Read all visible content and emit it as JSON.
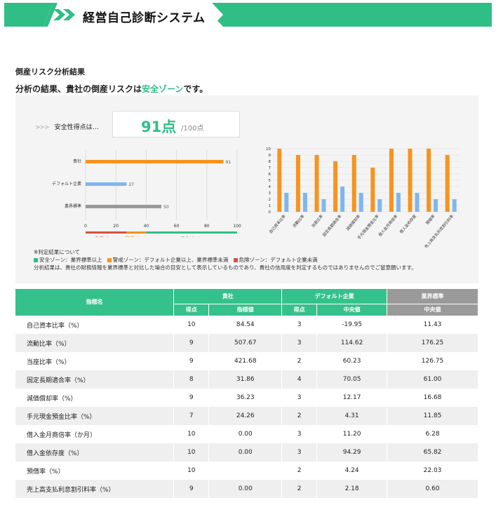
{
  "header": {
    "title": "経営自己診断システム",
    "arrow_icon": "double-chevron-right-icon"
  },
  "section_title": "倒産リスク分析結果",
  "result": {
    "prefix": "分析の結果、貴社の倒産リスクは",
    "zone": "安全ゾーン",
    "suffix": "です。"
  },
  "score": {
    "label": "安全性得点は…",
    "value": "91点",
    "max": "/100点"
  },
  "colors": {
    "green": "#2fbf86",
    "orange": "#f7931e",
    "blue": "#7fb6ee",
    "gray": "#9a9a9a",
    "red": "#d9503f"
  },
  "notes": {
    "heading": "※判定結果について",
    "safe": "安全ゾーン：業界標準以上",
    "warn": "警戒ゾーン：デフォルト企業以上、業界標準未満",
    "danger": "危険ゾーン：デフォルト企業未満",
    "disclaimer": "分析結果は、貴社の財務情報を業界標準と対比した場合の目安として表示しているものであり、貴社の信用度を判定するものではありませんのでご留意願います。"
  },
  "chart_data": [
    {
      "type": "bar",
      "orientation": "horizontal",
      "categories": [
        "貴社",
        "デフォルト企業",
        "業界標準"
      ],
      "values": [
        91,
        27,
        50
      ],
      "value_labels": [
        "91",
        "27",
        "50"
      ],
      "xlim": [
        0,
        100
      ],
      "ticks": [
        "0",
        "20",
        "40",
        "60",
        "80",
        "100"
      ],
      "zones": [
        {
          "label": "危険ゾーン",
          "from": 0,
          "to": 27,
          "color": "#d9503f"
        },
        {
          "label": "警戒ゾーン",
          "from": 27,
          "to": 40,
          "color": "#f7931e"
        },
        {
          "label": "安全ゾーン",
          "from": 40,
          "to": 100,
          "color": "#2fbf86"
        }
      ]
    },
    {
      "type": "bar",
      "categories": [
        "自己資本比率",
        "流動比率",
        "当座比率",
        "固定長期適合率",
        "減価償却率",
        "手元現金預金比率",
        "借入金月商倍率",
        "借入金依存度",
        "預借率",
        "売上高支払利息割引料率"
      ],
      "series": [
        {
          "values": [
            10,
            9,
            9,
            8,
            9,
            7,
            10,
            10,
            10,
            9
          ]
        },
        {
          "values": [
            3,
            3,
            2,
            4,
            3,
            2,
            3,
            3,
            2,
            2
          ]
        }
      ],
      "ylim": [
        0,
        10
      ],
      "ticks": [
        "0",
        "1",
        "2",
        "3",
        "4",
        "5",
        "6",
        "7",
        "8",
        "9",
        "10"
      ]
    }
  ],
  "table": {
    "col_name": "指標名",
    "group_company": "貴社",
    "group_default": "デフォルト企業",
    "group_industry": "業界標準",
    "sub_score": "得点",
    "sub_value": "指標値",
    "sub_median": "中央値",
    "rows": [
      {
        "name": "自己資本比率（%）",
        "score": "10",
        "value": "84.54",
        "d_score": "3",
        "d_median": "-19.95",
        "i_median": "11.43"
      },
      {
        "name": "流動比率（%）",
        "score": "9",
        "value": "507.67",
        "d_score": "3",
        "d_median": "114.62",
        "i_median": "176.25"
      },
      {
        "name": "当座比率（%）",
        "score": "9",
        "value": "421.68",
        "d_score": "2",
        "d_median": "60.23",
        "i_median": "126.75"
      },
      {
        "name": "固定長期適合率（%）",
        "score": "8",
        "value": "31.86",
        "d_score": "4",
        "d_median": "70.05",
        "i_median": "61.00"
      },
      {
        "name": "減価償却率（%）",
        "score": "9",
        "value": "36.23",
        "d_score": "3",
        "d_median": "12.17",
        "i_median": "16.68"
      },
      {
        "name": "手元現金預金比率（%）",
        "score": "7",
        "value": "24.26",
        "d_score": "2",
        "d_median": "4.31",
        "i_median": "11.85"
      },
      {
        "name": "借入金月商倍率（か月）",
        "score": "10",
        "value": "0.00",
        "d_score": "3",
        "d_median": "11.20",
        "i_median": "6.28"
      },
      {
        "name": "借入金依存度（%）",
        "score": "10",
        "value": "0.00",
        "d_score": "3",
        "d_median": "94.29",
        "i_median": "65.82"
      },
      {
        "name": "預借率（%）",
        "score": "10",
        "value": "",
        "d_score": "2",
        "d_median": "4.24",
        "i_median": "22.03"
      },
      {
        "name": "売上高支払利息割引料率（%）",
        "score": "9",
        "value": "0.00",
        "d_score": "2",
        "d_median": "2.18",
        "i_median": "0.60"
      }
    ]
  }
}
